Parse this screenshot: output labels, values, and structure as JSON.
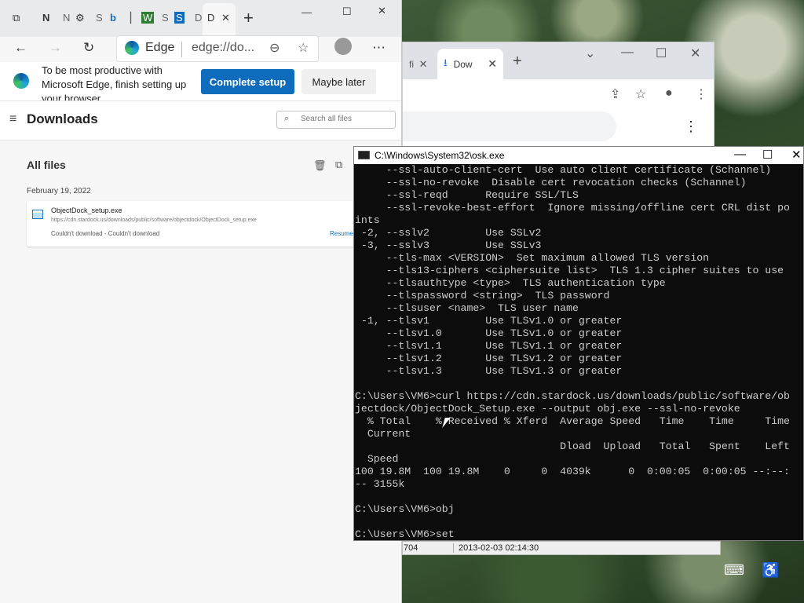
{
  "edge": {
    "tabs": [
      "N",
      "S",
      "S",
      "D"
    ],
    "toolbar": {
      "brand": "Edge",
      "url": "edge://do..."
    },
    "banner": {
      "message": "To be most productive with Microsoft Edge, finish setting up your browser.",
      "complete_label": "Complete setup",
      "later_label": "Maybe later"
    },
    "downloads": {
      "title": "Downloads",
      "search_placeholder": "Search all files",
      "section_label": "All files",
      "date": "February 19, 2022",
      "item": {
        "filename": "ObjectDock_setup.exe",
        "url": "https://cdn.stardock.us/downloads/public/software/objectdock/ObjectDock_setup.exe",
        "status": "Couldn't download - Couldn't download",
        "action": "Resume"
      }
    }
  },
  "chrome": {
    "tab_label": "Dow"
  },
  "console": {
    "title": "C:\\Windows\\System32\\osk.exe",
    "text": "     --ssl-auto-client-cert  Use auto client certificate (Schannel)\n     --ssl-no-revoke  Disable cert revocation checks (Schannel)\n     --ssl-reqd      Require SSL/TLS\n     --ssl-revoke-best-effort  Ignore missing/offline cert CRL dist po\nints\n -2, --sslv2         Use SSLv2\n -3, --sslv3         Use SSLv3\n     --tls-max <VERSION>  Set maximum allowed TLS version\n     --tls13-ciphers <ciphersuite list>  TLS 1.3 cipher suites to use\n     --tlsauthtype <type>  TLS authentication type\n     --tlspassword <string>  TLS password\n     --tlsuser <name>  TLS user name\n -1, --tlsv1         Use TLSv1.0 or greater\n     --tlsv1.0       Use TLSv1.0 or greater\n     --tlsv1.1       Use TLSv1.1 or greater\n     --tlsv1.2       Use TLSv1.2 or greater\n     --tlsv1.3       Use TLSv1.3 or greater\n\nC:\\Users\\VM6>curl https://cdn.stardock.us/downloads/public/software/ob\njectdock/ObjectDock_Setup.exe --output obj.exe --ssl-no-revoke\n  % Total    % Received % Xferd  Average Speed   Time    Time     Time\n  Current\n                                 Dload  Upload   Total   Spent    Left\n  Speed\n100 19.8M  100 19.8M    0     0  4039k      0  0:00:05  0:00:05 --:--:\n-- 3155k\n\nC:\\Users\\VM6>obj\n\nC:\\Users\\VM6>set"
  },
  "statusbar": {
    "left": "704",
    "timestamp": "2013-02-03 02:14:30"
  },
  "colors": {
    "edge_accent": "#0f6cbd",
    "chrome_accent": "#1a73e8",
    "console_bg": "#0c0c0c",
    "console_fg": "#cccccc"
  },
  "icons": [
    "tab-actions-icon",
    "settings-icon",
    "bing-icon",
    "back-icon",
    "forward-icon",
    "refresh-icon",
    "zoom-icon",
    "favorites-icon",
    "profile-icon",
    "more-icon",
    "hamburger-icon",
    "search-icon",
    "trash-icon",
    "open-folder-icon",
    "file-icon",
    "download-icon",
    "share-icon",
    "star-icon",
    "osk-icon",
    "accessibility-icon"
  ]
}
